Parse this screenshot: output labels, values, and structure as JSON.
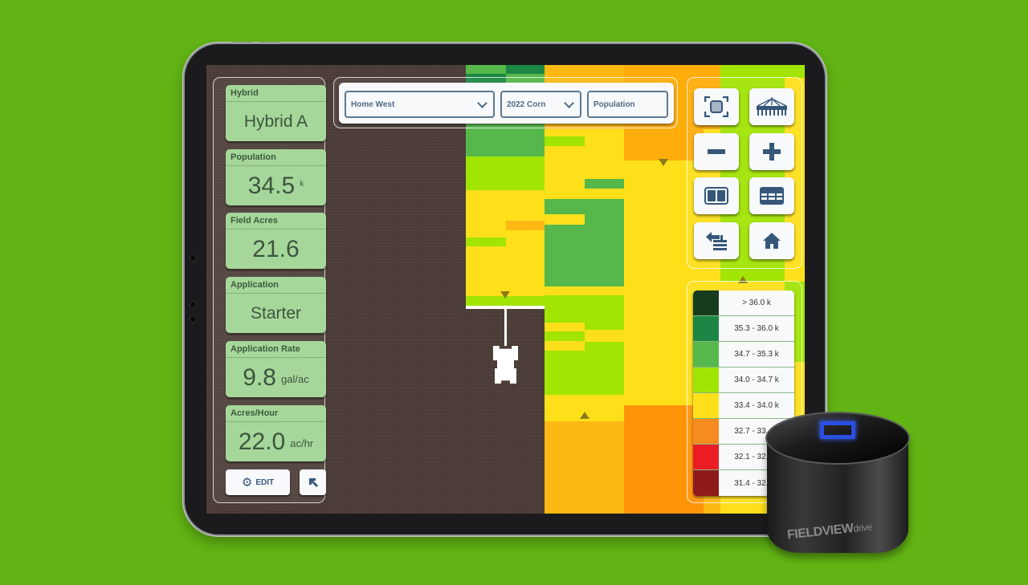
{
  "left_panel": {
    "cards": [
      {
        "label": "Hybrid",
        "value": "Hybrid A",
        "unit": ""
      },
      {
        "label": "Population",
        "value": "34.5",
        "unit": "k"
      },
      {
        "label": "Field Acres",
        "value": "21.6",
        "unit": ""
      },
      {
        "label": "Application",
        "value": "Starter",
        "unit": ""
      },
      {
        "label": "Application Rate",
        "value": "9.8",
        "unit": "gal/ac"
      },
      {
        "label": "Acres/Hour",
        "value": "22.0",
        "unit": "ac/hr"
      }
    ],
    "edit_label": "EDIT",
    "edit_icon": "gear-icon",
    "expand_icon": "arrow-up-left-icon"
  },
  "top_bar": {
    "field": "Home West",
    "season": "2022 Corn",
    "layer": "Population"
  },
  "map_tools": [
    {
      "name": "recenter",
      "icon": "focus-frame-icon"
    },
    {
      "name": "implement",
      "icon": "planter-icon"
    },
    {
      "name": "zoom-out",
      "icon": "minus-icon"
    },
    {
      "name": "zoom-in",
      "icon": "plus-icon"
    },
    {
      "name": "split-view",
      "icon": "split-view-icon"
    },
    {
      "name": "table-view",
      "icon": "table-icon"
    },
    {
      "name": "back-list",
      "icon": "back-list-icon"
    },
    {
      "name": "home",
      "icon": "home-icon"
    }
  ],
  "legend": [
    {
      "label": "> 36.0 k",
      "color": "#173d1f"
    },
    {
      "label": "35.3 - 36.0 k",
      "color": "#1c8745"
    },
    {
      "label": "34.7 - 35.3 k",
      "color": "#56b84a"
    },
    {
      "label": "34.0 - 34.7 k",
      "color": "#a2e404"
    },
    {
      "label": "33.4 - 34.0 k",
      "color": "#fde01a"
    },
    {
      "label": "32.7 - 33.4 k",
      "color": "#f68b1f"
    },
    {
      "label": "32.1 - 32.7 k",
      "color": "#ec1c24"
    },
    {
      "label": "31.4 - 32.1 k",
      "color": "#8e1a1a"
    }
  ],
  "device": {
    "logo": "FIELDVIEW",
    "logo_suffix": "drive"
  },
  "colors": {
    "background": "#62b414",
    "card": "#a6d79a",
    "accent": "#36577a"
  }
}
